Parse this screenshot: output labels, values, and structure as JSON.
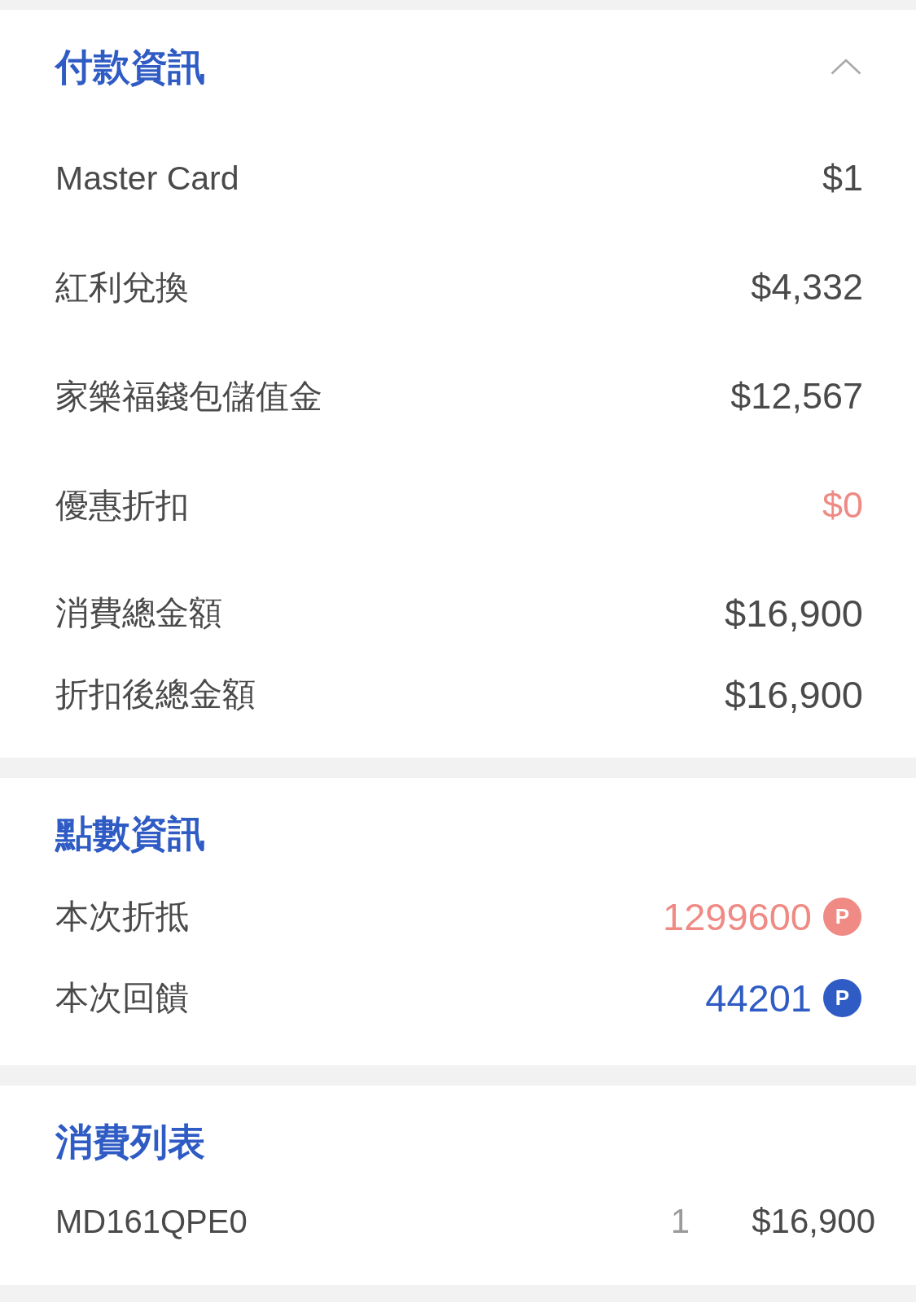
{
  "payment_info": {
    "title": "付款資訊",
    "expanded": true,
    "rows": [
      {
        "label": "Master Card",
        "value": "$1",
        "kind": "amount"
      },
      {
        "label": "紅利兌換",
        "value": "$4,332",
        "kind": "amount"
      },
      {
        "label": "家樂福錢包儲值金",
        "value": "$12,567",
        "kind": "amount"
      },
      {
        "label": "優惠折扣",
        "value": "$0",
        "kind": "discount"
      }
    ],
    "totals": [
      {
        "label": "消費總金額",
        "value": "$16,900"
      },
      {
        "label": "折扣後總金額",
        "value": "$16,900"
      }
    ]
  },
  "points_info": {
    "title": "點數資訊",
    "rows": [
      {
        "label": "本次折抵",
        "value": "1299600",
        "unit": "P",
        "color": "#ef8a84"
      },
      {
        "label": "本次回饋",
        "value": "44201",
        "unit": "P",
        "color": "#2f5bc4"
      }
    ]
  },
  "purchase_list": {
    "title": "消費列表",
    "items": [
      {
        "name": "MD161QPE0",
        "quantity": "1",
        "price": "$16,900"
      }
    ]
  }
}
